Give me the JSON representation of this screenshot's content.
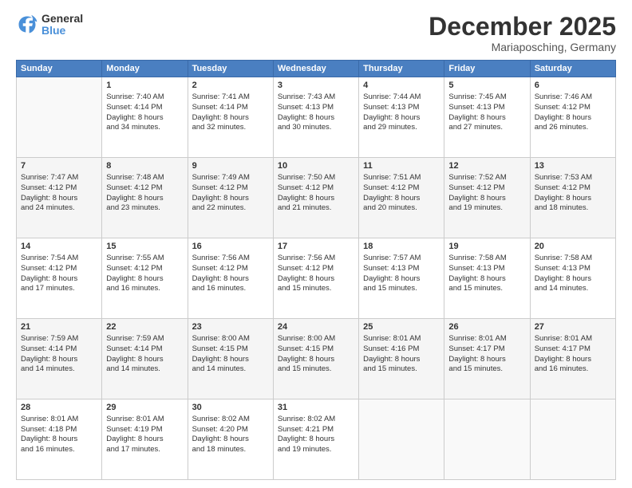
{
  "logo": {
    "general": "General",
    "blue": "Blue"
  },
  "title": "December 2025",
  "location": "Mariaposching, Germany",
  "days_header": [
    "Sunday",
    "Monday",
    "Tuesday",
    "Wednesday",
    "Thursday",
    "Friday",
    "Saturday"
  ],
  "weeks": [
    [
      {
        "day": "",
        "content": ""
      },
      {
        "day": "1",
        "content": "Sunrise: 7:40 AM\nSunset: 4:14 PM\nDaylight: 8 hours\nand 34 minutes."
      },
      {
        "day": "2",
        "content": "Sunrise: 7:41 AM\nSunset: 4:14 PM\nDaylight: 8 hours\nand 32 minutes."
      },
      {
        "day": "3",
        "content": "Sunrise: 7:43 AM\nSunset: 4:13 PM\nDaylight: 8 hours\nand 30 minutes."
      },
      {
        "day": "4",
        "content": "Sunrise: 7:44 AM\nSunset: 4:13 PM\nDaylight: 8 hours\nand 29 minutes."
      },
      {
        "day": "5",
        "content": "Sunrise: 7:45 AM\nSunset: 4:13 PM\nDaylight: 8 hours\nand 27 minutes."
      },
      {
        "day": "6",
        "content": "Sunrise: 7:46 AM\nSunset: 4:12 PM\nDaylight: 8 hours\nand 26 minutes."
      }
    ],
    [
      {
        "day": "7",
        "content": "Sunrise: 7:47 AM\nSunset: 4:12 PM\nDaylight: 8 hours\nand 24 minutes."
      },
      {
        "day": "8",
        "content": "Sunrise: 7:48 AM\nSunset: 4:12 PM\nDaylight: 8 hours\nand 23 minutes."
      },
      {
        "day": "9",
        "content": "Sunrise: 7:49 AM\nSunset: 4:12 PM\nDaylight: 8 hours\nand 22 minutes."
      },
      {
        "day": "10",
        "content": "Sunrise: 7:50 AM\nSunset: 4:12 PM\nDaylight: 8 hours\nand 21 minutes."
      },
      {
        "day": "11",
        "content": "Sunrise: 7:51 AM\nSunset: 4:12 PM\nDaylight: 8 hours\nand 20 minutes."
      },
      {
        "day": "12",
        "content": "Sunrise: 7:52 AM\nSunset: 4:12 PM\nDaylight: 8 hours\nand 19 minutes."
      },
      {
        "day": "13",
        "content": "Sunrise: 7:53 AM\nSunset: 4:12 PM\nDaylight: 8 hours\nand 18 minutes."
      }
    ],
    [
      {
        "day": "14",
        "content": "Sunrise: 7:54 AM\nSunset: 4:12 PM\nDaylight: 8 hours\nand 17 minutes."
      },
      {
        "day": "15",
        "content": "Sunrise: 7:55 AM\nSunset: 4:12 PM\nDaylight: 8 hours\nand 16 minutes."
      },
      {
        "day": "16",
        "content": "Sunrise: 7:56 AM\nSunset: 4:12 PM\nDaylight: 8 hours\nand 16 minutes."
      },
      {
        "day": "17",
        "content": "Sunrise: 7:56 AM\nSunset: 4:12 PM\nDaylight: 8 hours\nand 15 minutes."
      },
      {
        "day": "18",
        "content": "Sunrise: 7:57 AM\nSunset: 4:13 PM\nDaylight: 8 hours\nand 15 minutes."
      },
      {
        "day": "19",
        "content": "Sunrise: 7:58 AM\nSunset: 4:13 PM\nDaylight: 8 hours\nand 15 minutes."
      },
      {
        "day": "20",
        "content": "Sunrise: 7:58 AM\nSunset: 4:13 PM\nDaylight: 8 hours\nand 14 minutes."
      }
    ],
    [
      {
        "day": "21",
        "content": "Sunrise: 7:59 AM\nSunset: 4:14 PM\nDaylight: 8 hours\nand 14 minutes."
      },
      {
        "day": "22",
        "content": "Sunrise: 7:59 AM\nSunset: 4:14 PM\nDaylight: 8 hours\nand 14 minutes."
      },
      {
        "day": "23",
        "content": "Sunrise: 8:00 AM\nSunset: 4:15 PM\nDaylight: 8 hours\nand 14 minutes."
      },
      {
        "day": "24",
        "content": "Sunrise: 8:00 AM\nSunset: 4:15 PM\nDaylight: 8 hours\nand 15 minutes."
      },
      {
        "day": "25",
        "content": "Sunrise: 8:01 AM\nSunset: 4:16 PM\nDaylight: 8 hours\nand 15 minutes."
      },
      {
        "day": "26",
        "content": "Sunrise: 8:01 AM\nSunset: 4:17 PM\nDaylight: 8 hours\nand 15 minutes."
      },
      {
        "day": "27",
        "content": "Sunrise: 8:01 AM\nSunset: 4:17 PM\nDaylight: 8 hours\nand 16 minutes."
      }
    ],
    [
      {
        "day": "28",
        "content": "Sunrise: 8:01 AM\nSunset: 4:18 PM\nDaylight: 8 hours\nand 16 minutes."
      },
      {
        "day": "29",
        "content": "Sunrise: 8:01 AM\nSunset: 4:19 PM\nDaylight: 8 hours\nand 17 minutes."
      },
      {
        "day": "30",
        "content": "Sunrise: 8:02 AM\nSunset: 4:20 PM\nDaylight: 8 hours\nand 18 minutes."
      },
      {
        "day": "31",
        "content": "Sunrise: 8:02 AM\nSunset: 4:21 PM\nDaylight: 8 hours\nand 19 minutes."
      },
      {
        "day": "",
        "content": ""
      },
      {
        "day": "",
        "content": ""
      },
      {
        "day": "",
        "content": ""
      }
    ]
  ]
}
